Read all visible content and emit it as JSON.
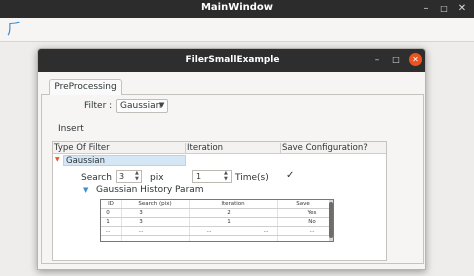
{
  "main_window": {
    "title": "MainWindow",
    "controls": {
      "minimize": "–",
      "maximize": "□",
      "close": "✕"
    },
    "toolbar_icon": "⺁"
  },
  "dialog": {
    "title": "FilerSmallExample",
    "controls": {
      "minimize": "–",
      "maximize": "□",
      "close": "✕"
    },
    "tabs": [
      {
        "label": "PreProcessing"
      }
    ],
    "filter": {
      "label": "Filter :",
      "value": "Gaussian"
    },
    "insert_label": "Insert",
    "tree": {
      "headers": [
        "Type Of Filter",
        "Iteration",
        "Save Configuration?"
      ],
      "item": {
        "label": "Gaussian",
        "search_label": "Search",
        "search_value": "3",
        "pix_label": "pix",
        "iteration_value": "1",
        "times_label": "Time(s)",
        "save_checked": "✓",
        "history_label": "Gaussian History Param",
        "history_table": {
          "headers": [
            "ID",
            "Search (pix)",
            "Iteration",
            "Save"
          ],
          "rows": [
            [
              "0",
              "3",
              "2",
              "Yes"
            ],
            [
              "1",
              "3",
              "1",
              "No"
            ],
            [
              "...",
              "...",
              "...",
              "...",
              "..."
            ]
          ]
        }
      }
    }
  }
}
